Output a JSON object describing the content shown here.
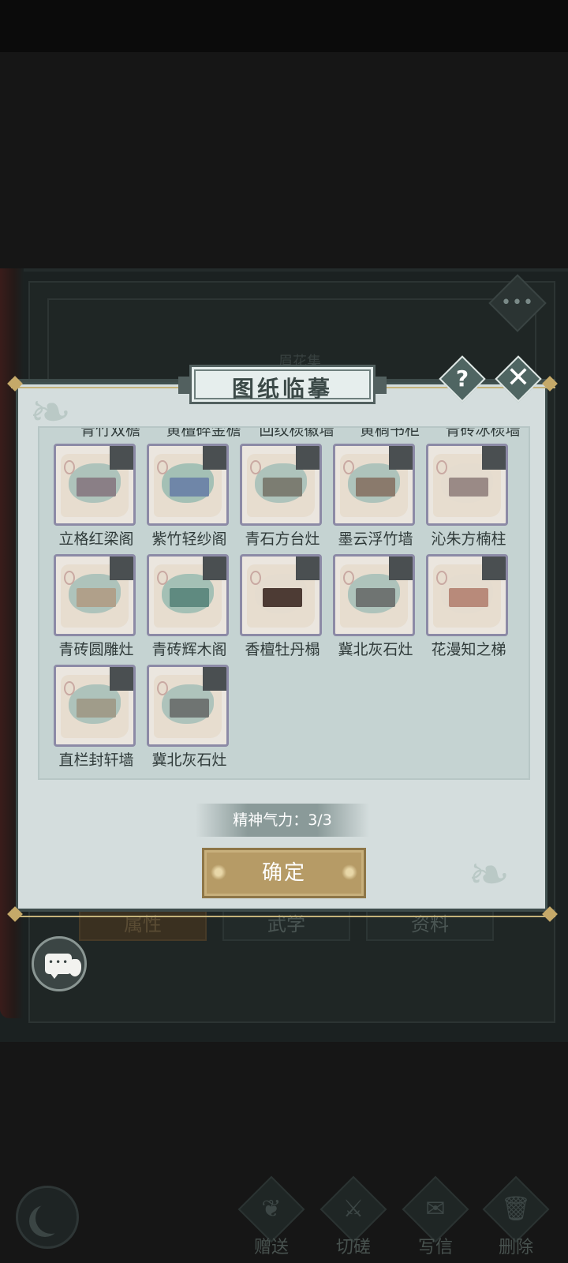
{
  "background": {
    "book_title": "眉花集",
    "tabs": [
      "属性",
      "武学",
      "资料"
    ],
    "more_icon": "more-dots-icon",
    "bottom_actions": [
      {
        "label": "赠送",
        "icon": "scroll-icon"
      },
      {
        "label": "切磋",
        "icon": "sword-icon"
      },
      {
        "label": "写信",
        "icon": "letter-icon"
      },
      {
        "label": "删除",
        "icon": "trash-icon"
      }
    ]
  },
  "dialog": {
    "title": "图纸临摹",
    "help_glyph": "?",
    "close_glyph": "✕",
    "partial_row": [
      "青竹双檐",
      "黄檀碎金檐",
      "回纹棂徽墙",
      "黄榈书柜",
      "青砖冰棂墙"
    ],
    "items": [
      {
        "name": "立格红梁阁",
        "wash": "#8fb6b0",
        "model": "#8a7f86"
      },
      {
        "name": "紫竹轻纱阁",
        "wash": "#7fb0a8",
        "model": "#6f86a8"
      },
      {
        "name": "青石方台灶",
        "wash": "#8fb6b0",
        "model": "#7c7d72"
      },
      {
        "name": "墨云浮竹墙",
        "wash": "#8fb6b0",
        "model": "#8a7a6c"
      },
      {
        "name": "沁朱方楠柱",
        "wash": "#e3dccf",
        "model": "#9a8a86"
      },
      {
        "name": "青砖圆雕灶",
        "wash": "#8fb6b0",
        "model": "#b0a08a"
      },
      {
        "name": "青砖辉木阁",
        "wash": "#7fb0a8",
        "model": "#5f8a80"
      },
      {
        "name": "香檀牡丹榻",
        "wash": "#e3dccf",
        "model": "#4d3b34"
      },
      {
        "name": "冀北灰石灶",
        "wash": "#8fb6b0",
        "model": "#6f7472"
      },
      {
        "name": "花漫知之梯",
        "wash": "#e3dccf",
        "model": "#b88a7a"
      },
      {
        "name": "直栏封轩墙",
        "wash": "#8fb6b0",
        "model": "#a09c8a"
      },
      {
        "name": "冀北灰石灶",
        "wash": "#8fb6b0",
        "model": "#6f7472"
      }
    ],
    "stamina_text": "精神气力：3/3",
    "confirm_label": "确定"
  },
  "colors": {
    "dialog_bg": "#d4dddd",
    "panel_bg": "#c5d3d2",
    "accent_gold": "#b69b66",
    "frame_dark": "#3f4f4e"
  }
}
